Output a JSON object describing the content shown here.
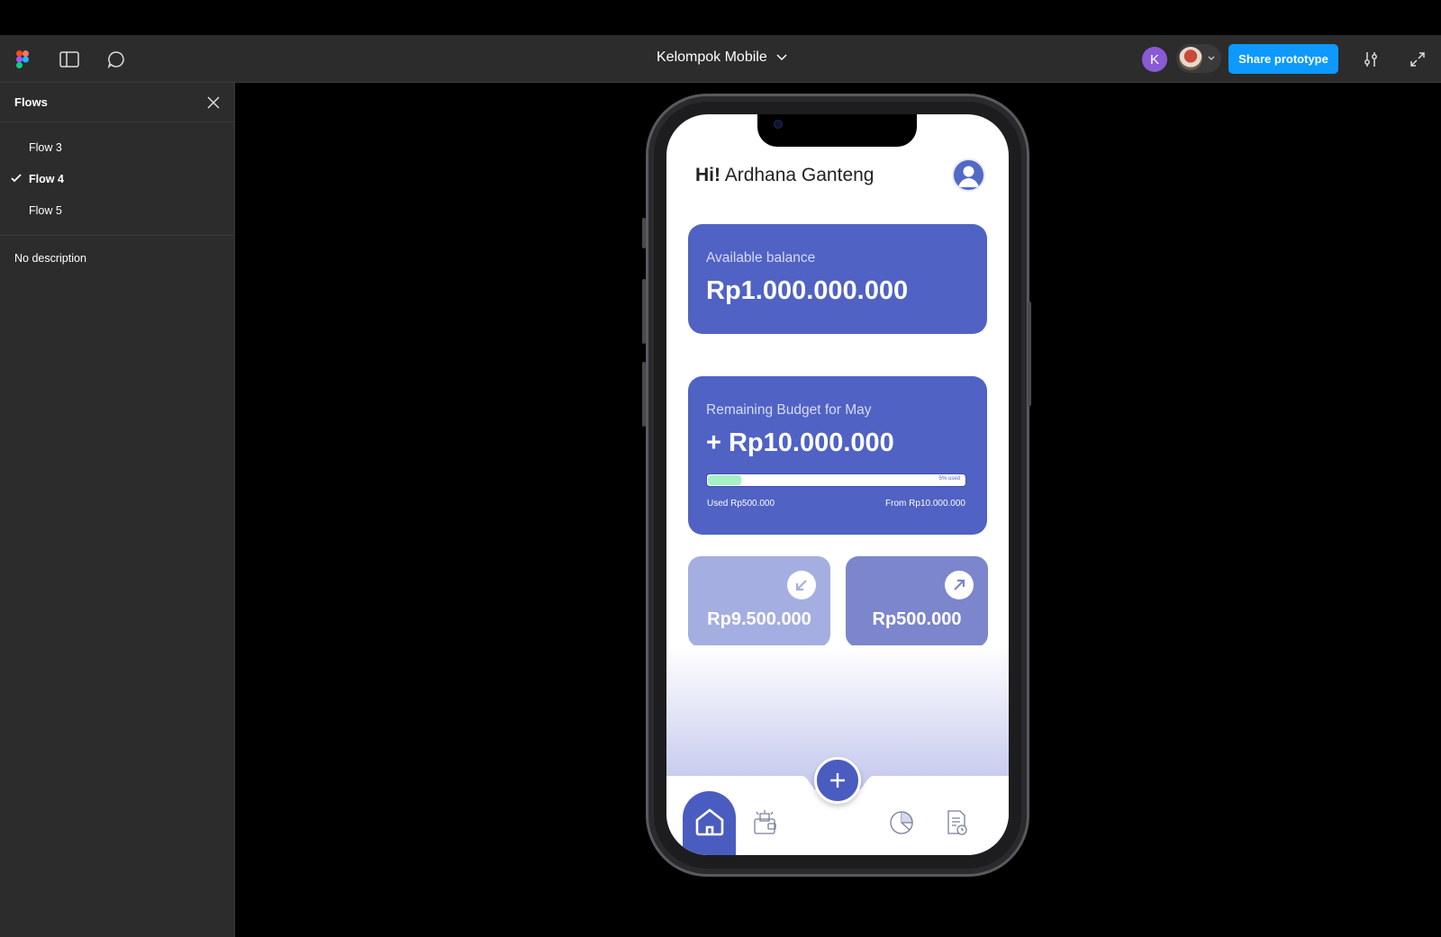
{
  "toolbar": {
    "file_title": "Kelompok Mobile",
    "avatar_initial": "K",
    "share_label": "Share prototype"
  },
  "sidebar": {
    "title": "Flows",
    "flows": [
      {
        "label": "Flow 3",
        "selected": false
      },
      {
        "label": "Flow 4",
        "selected": true
      },
      {
        "label": "Flow 5",
        "selected": false
      }
    ],
    "description": "No description"
  },
  "app": {
    "greeting_prefix": "Hi!",
    "greeting_name": "Ardhana Ganteng",
    "balance_label": "Available balance",
    "balance_value": "Rp1.000.000.000",
    "budget_label": "Remaining Budget for May",
    "budget_value": "+ Rp10.000.000",
    "budget_used_fraction": 0.05,
    "budget_used_badge": "5% used",
    "used_text": "Used Rp500.000",
    "from_text": "From Rp10.000.000",
    "income_value": "Rp9.500.000",
    "expense_value": "Rp500.000"
  },
  "colors": {
    "primary": "#5062c3",
    "share_button": "#0d99ff",
    "progress_fill": "#a6f0c6"
  }
}
